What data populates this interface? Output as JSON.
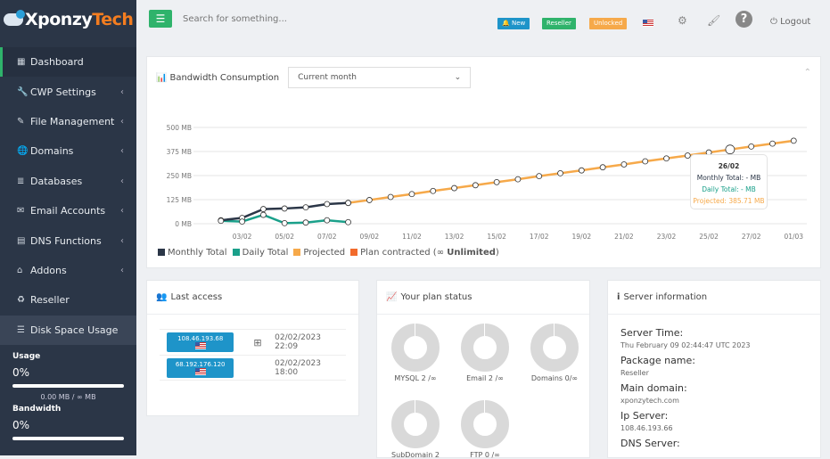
{
  "brand": {
    "part1": "Xponzy",
    "part2": "Tech"
  },
  "sidebar": {
    "items": [
      {
        "label": "Dashboard",
        "icon": "dashboard-icon",
        "chev": false
      },
      {
        "label": "CWP Settings",
        "icon": "wrench-icon",
        "chev": true
      },
      {
        "label": "File Management",
        "icon": "edit-icon",
        "chev": true
      },
      {
        "label": "Domains",
        "icon": "globe-icon",
        "chev": true
      },
      {
        "label": "Databases",
        "icon": "database-icon",
        "chev": true
      },
      {
        "label": "Email Accounts",
        "icon": "envelope-icon",
        "chev": true
      },
      {
        "label": "DNS Functions",
        "icon": "server-icon",
        "chev": true
      },
      {
        "label": "Addons",
        "icon": "bank-icon",
        "chev": true
      },
      {
        "label": "Reseller",
        "icon": "recycle-icon",
        "chev": false
      },
      {
        "label": "Disk Space Usage",
        "icon": "list-icon",
        "chev": false
      }
    ],
    "usage": {
      "label": "Usage",
      "percent": "0%",
      "progress": 0,
      "detail": "0.00 MB / ∞ MB"
    },
    "bandwidth": {
      "label": "Bandwidth",
      "percent": "0%",
      "progress": 0
    }
  },
  "topbar": {
    "search_placeholder": "Search for something...",
    "badges": {
      "new": "New",
      "reseller": "Reseller",
      "unlocked": "Unlocked"
    },
    "logout": "Logout",
    "colors": {
      "new": "#1e94c9",
      "reseller": "#2fb36b",
      "unlocked": "#f6a94a"
    }
  },
  "bandwidth": {
    "title": "Bandwidth Consumption",
    "period": "Current month",
    "tooltip": {
      "date": "26/02",
      "monthly": "Monthly Total: - MB",
      "daily": "Daily Total: - MB",
      "projected": "Projected: 385.71 MB"
    },
    "legend": {
      "monthly": "Monthly Total",
      "daily": "Daily Total",
      "projected": "Projected",
      "plan": "Plan contracted (∞ ",
      "plan_bold": "Unlimited",
      "plan_end": ")"
    }
  },
  "chart_data": {
    "type": "line",
    "ylim": [
      0,
      500
    ],
    "ylabel": "",
    "xlabel": "",
    "yticks": [
      "0 MB",
      "125 MB",
      "250 MB",
      "375 MB",
      "500 MB"
    ],
    "xticks": [
      "03/02",
      "05/02",
      "07/02",
      "09/02",
      "11/02",
      "13/02",
      "15/02",
      "17/02",
      "19/02",
      "21/02",
      "23/02",
      "25/02",
      "27/02",
      "01/03"
    ],
    "x": [
      "02/02",
      "03/02",
      "04/02",
      "05/02",
      "06/02",
      "07/02",
      "08/02",
      "09/02",
      "10/02",
      "11/02",
      "12/02",
      "13/02",
      "14/02",
      "15/02",
      "16/02",
      "17/02",
      "18/02",
      "19/02",
      "20/02",
      "21/02",
      "22/02",
      "23/02",
      "24/02",
      "25/02",
      "26/02",
      "27/02",
      "28/02",
      "01/03"
    ],
    "series": [
      {
        "name": "Monthly Total",
        "color": "#2b3647",
        "values": [
          18,
          30,
          76,
          79,
          85,
          102,
          108
        ]
      },
      {
        "name": "Daily Total",
        "color": "#1aa08a",
        "values": [
          15,
          11,
          46,
          3,
          6,
          18,
          8
        ]
      },
      {
        "name": "Projected",
        "color": "#f6a94a",
        "values": [
          null,
          null,
          null,
          null,
          null,
          null,
          108,
          123,
          139,
          154,
          170,
          185,
          200,
          216,
          231,
          247,
          262,
          277,
          293,
          308,
          324,
          339,
          354,
          370,
          385.71,
          401,
          416,
          431
        ]
      }
    ],
    "plan_color": "#f26b2c",
    "grid": true,
    "legend": "bottom-left"
  },
  "last_access": {
    "title": "Last access",
    "rows": [
      {
        "ip": "108.46.193.68",
        "os": "windows-icon",
        "date": "02/02/2023 22:09"
      },
      {
        "ip": "68.192.176.120",
        "os": "apple-icon",
        "date": "02/02/2023 18:00"
      }
    ]
  },
  "plan": {
    "title": "Your plan status",
    "items": [
      "MYSQL 2 /∞",
      "Email 2 /∞",
      "Domains 0/∞",
      "SubDomain 2",
      "FTP 0 /∞"
    ]
  },
  "server": {
    "title": "Server information",
    "fields": [
      {
        "k": "Server Time:",
        "v": "Thu February 09 02:44:47 UTC 2023"
      },
      {
        "k": "Package name:",
        "v": "Reseller"
      },
      {
        "k": "Main domain:",
        "v": "xponzytech.com"
      },
      {
        "k": "Ip Server:",
        "v": "108.46.193.66"
      },
      {
        "k": "DNS Server:",
        "v": ""
      }
    ]
  }
}
